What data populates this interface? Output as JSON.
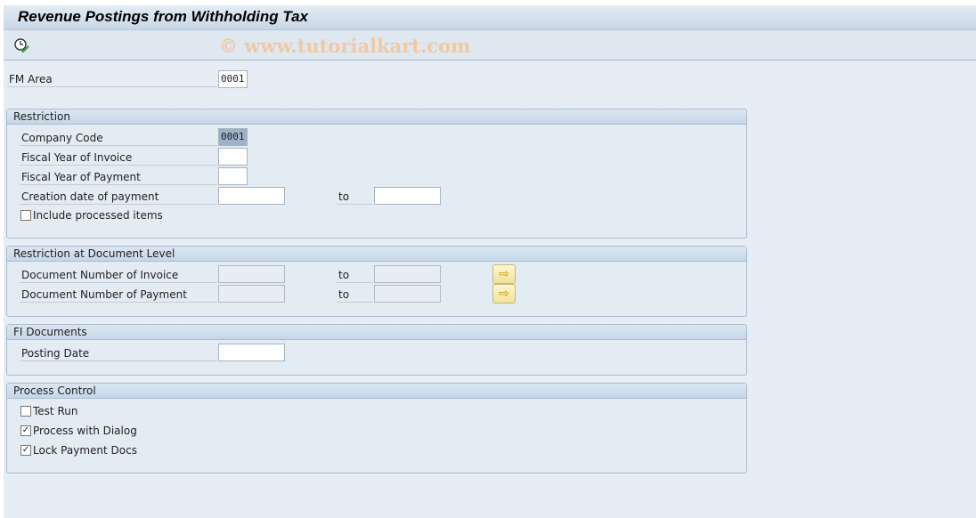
{
  "title": "Revenue Postings from Withholding Tax",
  "watermark": "© www.tutorialkart.com",
  "toolbar": {
    "execute_icon": "clock-execute-icon"
  },
  "fm_area": {
    "label": "FM Area",
    "value": "0001"
  },
  "restriction": {
    "title": "Restriction",
    "company_code": {
      "label": "Company Code",
      "value": "0001"
    },
    "fy_invoice": {
      "label": "Fiscal Year of Invoice",
      "value": ""
    },
    "fy_payment": {
      "label": "Fiscal Year of Payment",
      "value": ""
    },
    "creation_date": {
      "label": "Creation date of payment",
      "from": "",
      "to_label": "to",
      "to": ""
    },
    "include_processed": {
      "label": "Include processed items",
      "checked": false
    }
  },
  "doc_level": {
    "title": "Restriction at Document Level",
    "invoice": {
      "label": "Document Number of Invoice",
      "from": "",
      "to_label": "to",
      "to": ""
    },
    "payment": {
      "label": "Document Number of Payment",
      "from": "",
      "to_label": "to",
      "to": ""
    }
  },
  "fi_docs": {
    "title": "FI Documents",
    "posting_date": {
      "label": "Posting Date",
      "value": ""
    }
  },
  "process": {
    "title": "Process Control",
    "test_run": {
      "label": "Test Run",
      "checked": false
    },
    "dialog": {
      "label": "Process with Dialog",
      "checked": true
    },
    "lock": {
      "label": "Lock Payment Docs",
      "checked": true
    }
  },
  "check_mark": "✓"
}
